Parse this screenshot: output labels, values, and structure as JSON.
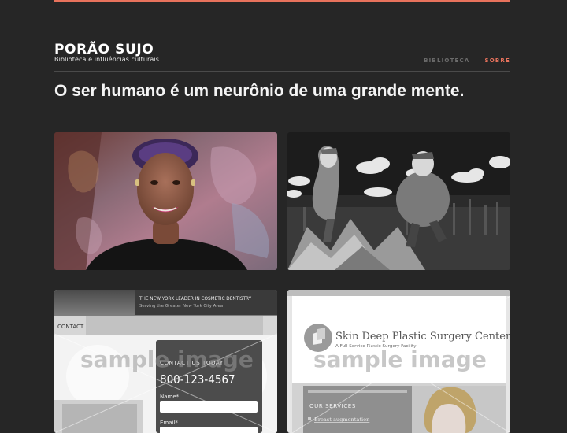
{
  "site": {
    "title": "PORÃO SUJO",
    "subtitle": "Biblioteca e influências culturais"
  },
  "nav": {
    "items": [
      {
        "label": "BIBLIOTECA",
        "active": false
      },
      {
        "label": "SOBRE",
        "active": true
      }
    ]
  },
  "headline": "O ser humano é um neurônio de uma grande mente.",
  "colors": {
    "background": "#262626",
    "accent": "#e8725c",
    "nav_inactive": "#6b6b6b",
    "divider": "#4a4a4a"
  },
  "cards": [
    {
      "kind": "video-thumbnail-portrait"
    },
    {
      "kind": "illustration-two-figures"
    },
    {
      "kind": "sample-template-cosmetic",
      "banner_line1": "THE NEW YORK LEADER IN COSMETIC DENTISTRY",
      "banner_line2": "Serving the Greater New York City Area",
      "tab_label": "CONTACT",
      "box_title": "CONTACT US TODAY",
      "phone": "800-123-4567",
      "name_label": "Name*",
      "email_label": "Email*",
      "watermark": "sample image"
    },
    {
      "kind": "sample-template-plastic-surgery",
      "title": "Skin Deep Plastic Surgery Center",
      "tagline": "A Full-Service Plastic Surgery Facility",
      "services_label": "OUR SERVICES",
      "service_item": "Breast augmentation",
      "watermark": "sample image"
    }
  ]
}
